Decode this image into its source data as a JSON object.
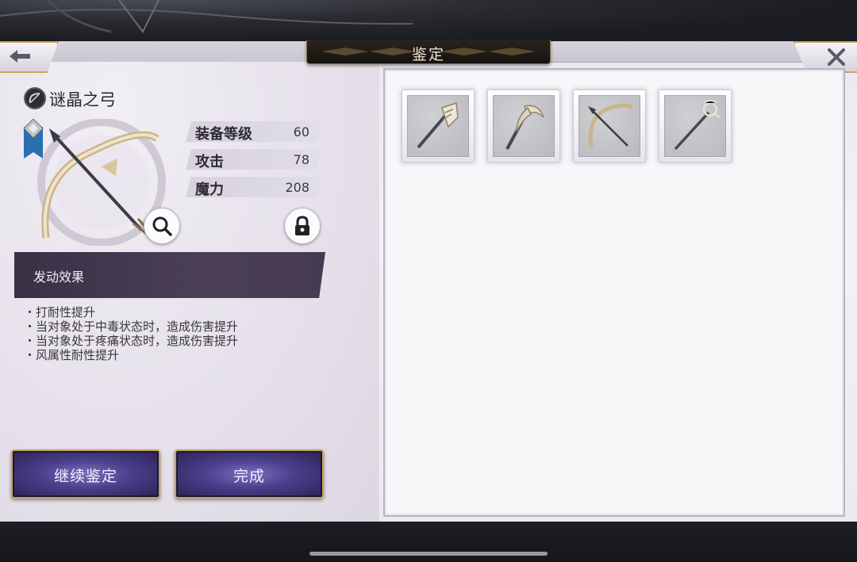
{
  "header": {
    "title": "鉴定"
  },
  "item": {
    "name": "谜晶之弓",
    "stats": [
      {
        "label": "装备等级",
        "value": "60"
      },
      {
        "label": "攻击",
        "value": "78"
      },
      {
        "label": "魔力",
        "value": "208"
      }
    ],
    "effect_title": "发动效果",
    "effects": [
      "打耐性提升",
      "当对象处于中毒状态时，造成伤害提升",
      "当对象处于疼痛状态时，造成伤害提升",
      "风属性耐性提升"
    ]
  },
  "actions": {
    "continue_label": "继续鉴定",
    "done_label": "完成"
  },
  "inventory": {
    "slots": [
      {
        "icon": "staff-icon"
      },
      {
        "icon": "scythe-icon"
      },
      {
        "icon": "bow-icon"
      },
      {
        "icon": "wand-icon"
      }
    ]
  },
  "colors": {
    "accent_gold": "#c9a45d",
    "button_purple": "#4a3e8a",
    "effect_band": "#3a3145"
  }
}
